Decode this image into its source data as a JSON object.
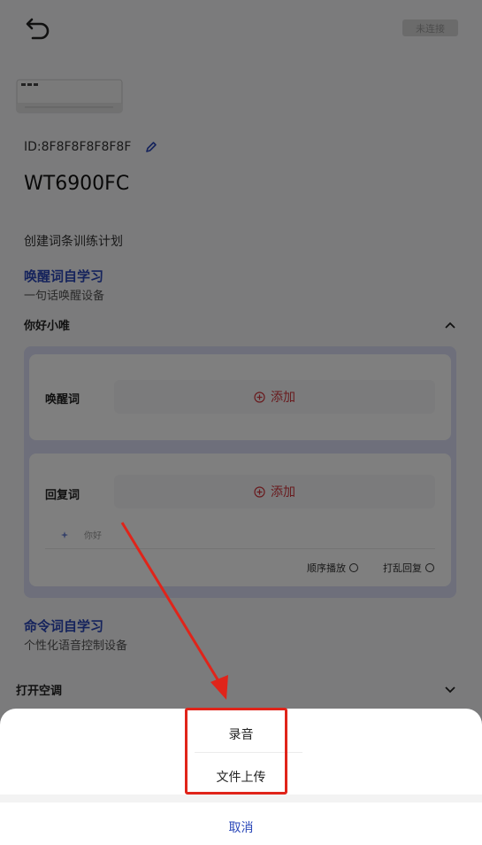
{
  "header": {
    "back_icon": "undo-arrow-icon",
    "status_badge": "未连接"
  },
  "device": {
    "image_icon": "air-conditioner-icon",
    "id_text": "ID:8F8F8F8F8F8F",
    "edit_icon": "pencil-icon",
    "model": "WT6900FC"
  },
  "plan": {
    "title": "创建词条训练计划"
  },
  "wake_section": {
    "title": "唤醒词自学习",
    "subtitle": "一句话唤醒设备",
    "group_label": "你好小唯",
    "group_state_icon": "chevron-up-icon",
    "wake_card": {
      "label": "唤醒词",
      "add_label": "添加"
    },
    "reply_card": {
      "label": "回复词",
      "add_label": "添加",
      "reply_item": "你好",
      "options": [
        "顺序播放",
        "打乱回复"
      ]
    }
  },
  "command_section": {
    "title": "命令词自学习",
    "subtitle": "个性化语音控制设备",
    "group_label": "打开空调",
    "group_state_icon": "chevron-down-icon"
  },
  "action_sheet": {
    "items": [
      "录音",
      "文件上传"
    ],
    "cancel": "取消"
  },
  "annotation_colors": {
    "highlight": "#e0241a",
    "accent": "#2a47b8",
    "add_red": "#d2363d"
  }
}
